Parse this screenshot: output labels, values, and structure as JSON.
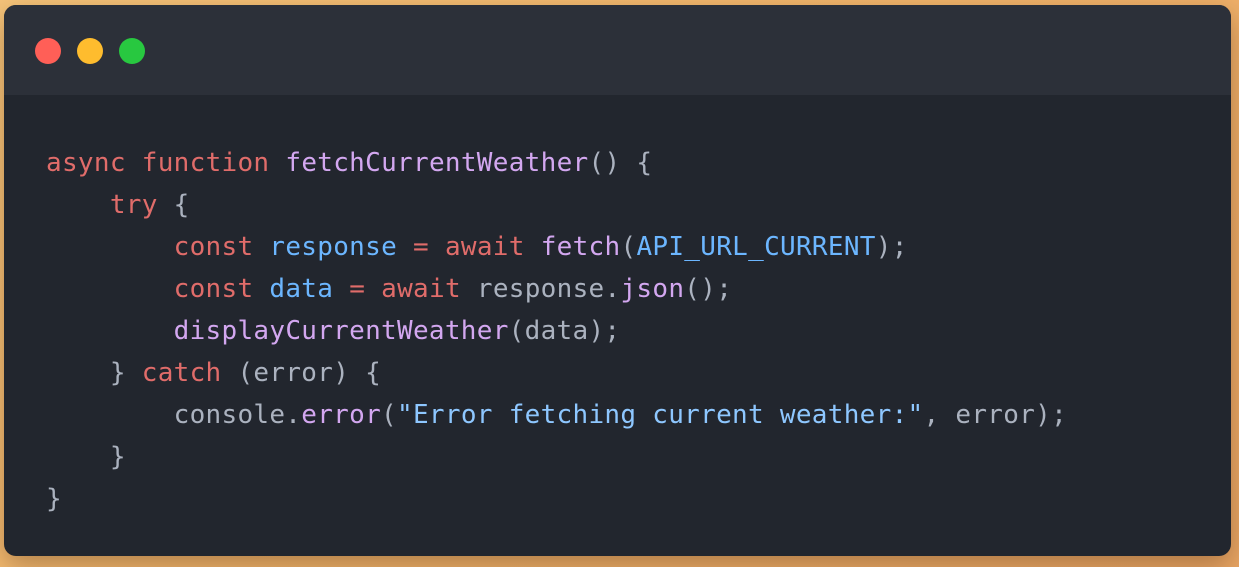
{
  "window": {
    "controls": [
      {
        "name": "close",
        "color": "#ff5f57"
      },
      {
        "name": "minimize",
        "color": "#febc2e"
      },
      {
        "name": "maximize",
        "color": "#28c840"
      }
    ]
  },
  "colors": {
    "background_gradient": [
      "#f6c47a",
      "#eaa765"
    ],
    "editor_bg": "#22262e",
    "titlebar_bg": "#2c3039",
    "keyword": "#e06c6a",
    "function": "#d3a7f0",
    "variable": "#6cb6ff",
    "string": "#8ec7ff",
    "plain": "#abb2bf"
  },
  "code": {
    "language": "javascript",
    "lines": [
      [
        {
          "t": "async",
          "c": "kw"
        },
        {
          "t": " ",
          "c": "plain"
        },
        {
          "t": "function",
          "c": "kw"
        },
        {
          "t": " ",
          "c": "plain"
        },
        {
          "t": "fetchCurrentWeather",
          "c": "fn"
        },
        {
          "t": "() {",
          "c": "plain"
        }
      ],
      [
        {
          "t": "    ",
          "c": "plain"
        },
        {
          "t": "try",
          "c": "kw"
        },
        {
          "t": " {",
          "c": "plain"
        }
      ],
      [
        {
          "t": "        ",
          "c": "plain"
        },
        {
          "t": "const",
          "c": "kw"
        },
        {
          "t": " ",
          "c": "plain"
        },
        {
          "t": "response",
          "c": "var"
        },
        {
          "t": " ",
          "c": "plain"
        },
        {
          "t": "=",
          "c": "kw"
        },
        {
          "t": " ",
          "c": "plain"
        },
        {
          "t": "await",
          "c": "kw"
        },
        {
          "t": " ",
          "c": "plain"
        },
        {
          "t": "fetch",
          "c": "fn"
        },
        {
          "t": "(",
          "c": "plain"
        },
        {
          "t": "API_URL_CURRENT",
          "c": "var"
        },
        {
          "t": ");",
          "c": "plain"
        }
      ],
      [
        {
          "t": "        ",
          "c": "plain"
        },
        {
          "t": "const",
          "c": "kw"
        },
        {
          "t": " ",
          "c": "plain"
        },
        {
          "t": "data",
          "c": "var"
        },
        {
          "t": " ",
          "c": "plain"
        },
        {
          "t": "=",
          "c": "kw"
        },
        {
          "t": " ",
          "c": "plain"
        },
        {
          "t": "await",
          "c": "kw"
        },
        {
          "t": " response.",
          "c": "plain"
        },
        {
          "t": "json",
          "c": "fn"
        },
        {
          "t": "();",
          "c": "plain"
        }
      ],
      [
        {
          "t": "        ",
          "c": "plain"
        },
        {
          "t": "displayCurrentWeather",
          "c": "fn"
        },
        {
          "t": "(data);",
          "c": "plain"
        }
      ],
      [
        {
          "t": "    } ",
          "c": "plain"
        },
        {
          "t": "catch",
          "c": "kw"
        },
        {
          "t": " (error) {",
          "c": "plain"
        }
      ],
      [
        {
          "t": "        console.",
          "c": "plain"
        },
        {
          "t": "error",
          "c": "fn"
        },
        {
          "t": "(",
          "c": "plain"
        },
        {
          "t": "\"Error fetching current weather:\"",
          "c": "str"
        },
        {
          "t": ", error);",
          "c": "plain"
        }
      ],
      [
        {
          "t": "    }",
          "c": "plain"
        }
      ],
      [
        {
          "t": "}",
          "c": "plain"
        }
      ]
    ]
  }
}
